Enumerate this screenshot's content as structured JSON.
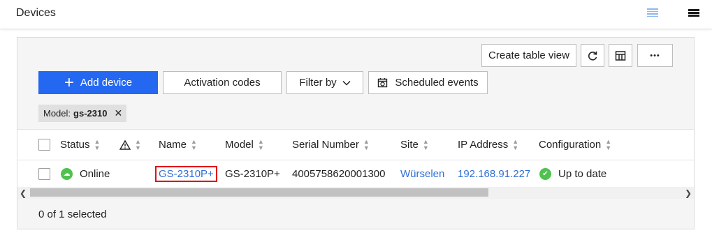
{
  "header": {
    "title": "Devices",
    "list_view_icon": "list-view-icon",
    "compact_view_icon": "compact-view-icon"
  },
  "toolbar": {
    "create_table_view": "Create table view",
    "refresh_icon": "refresh-icon",
    "columns_icon": "columns-icon",
    "more_label": "•••",
    "add_device": "Add device",
    "activation_codes": "Activation codes",
    "filter_by": "Filter by",
    "scheduled_events": "Scheduled events"
  },
  "filters": {
    "chip_key": "Model:",
    "chip_value": "gs-2310",
    "chip_remove": "✕"
  },
  "table": {
    "columns": [
      "Status",
      "",
      "Name",
      "Model",
      "Serial Number",
      "Site",
      "IP Address",
      "Configuration"
    ],
    "rows": [
      {
        "status": "Online",
        "name": "GS-2310P+",
        "model": "GS-2310P+",
        "serial": "4005758620001300",
        "site": "Würselen",
        "ip": "192.168.91.227",
        "configuration": "Up to date"
      }
    ]
  },
  "footer": {
    "selected": "0 of 1 selected"
  },
  "colors": {
    "primary": "#2468f2",
    "link": "#2f6fd6",
    "online": "#4fc24f",
    "highlight": "#e01010"
  }
}
